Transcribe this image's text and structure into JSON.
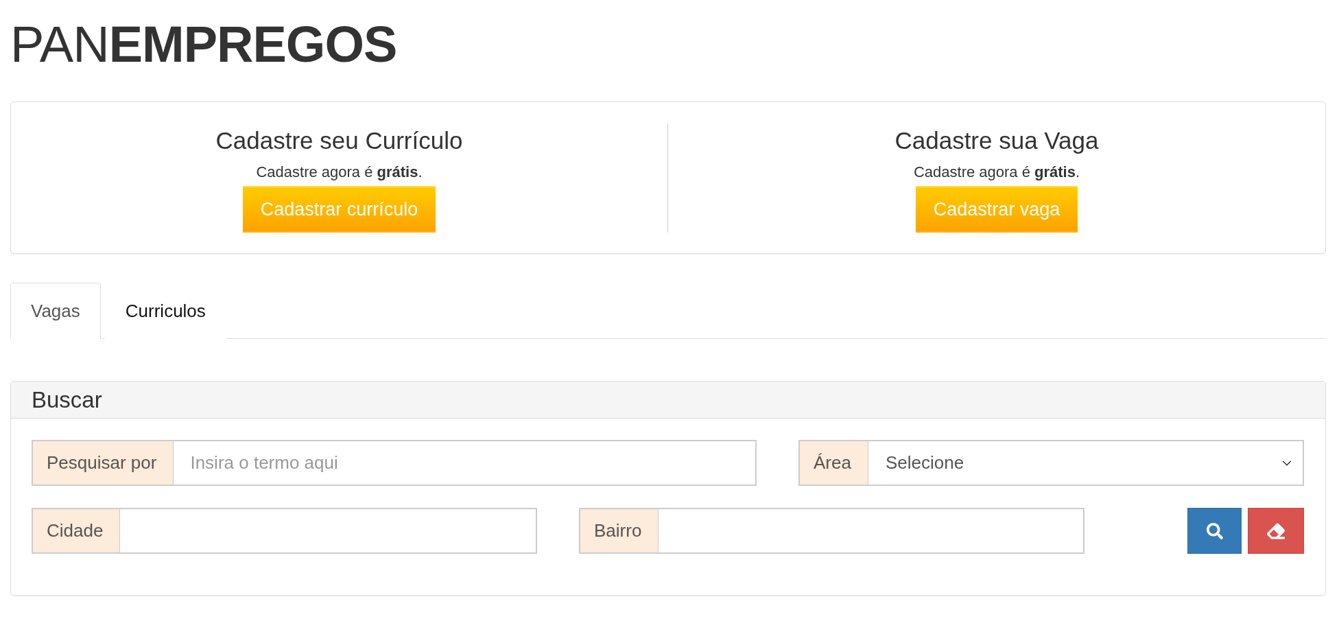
{
  "logo": {
    "text": "PAN**EMPREGOS**"
  },
  "promo_cards": [
    {
      "title": "Cadastre seu Currículo",
      "subtitle": "Cadastre agora é **grátis**.",
      "button": "Cadastrar currículo"
    },
    {
      "title": "Cadastre sua Vaga",
      "subtitle": "Cadastre agora é **grátis**.",
      "button": "Cadastrar vaga"
    }
  ],
  "tabs": [
    {
      "label": "Vagas",
      "selected": true
    },
    {
      "label": "Curriculos",
      "selected": false
    }
  ],
  "search_panel": {
    "title": "Buscar",
    "rows": [
      {
        "fields": [
          {
            "kind": "text",
            "label": "Pesquisar por",
            "placeholder": "Insira o termo aqui"
          },
          {
            "kind": "select",
            "label": "Área",
            "value": "Selecione"
          }
        ]
      },
      {
        "fields": [
          {
            "kind": "text",
            "label": "Cidade"
          },
          {
            "kind": "text",
            "label": "Bairro"
          }
        ],
        "buttons": [
          {
            "kind": "search"
          },
          {
            "kind": "clear"
          }
        ]
      }
    ]
  }
}
